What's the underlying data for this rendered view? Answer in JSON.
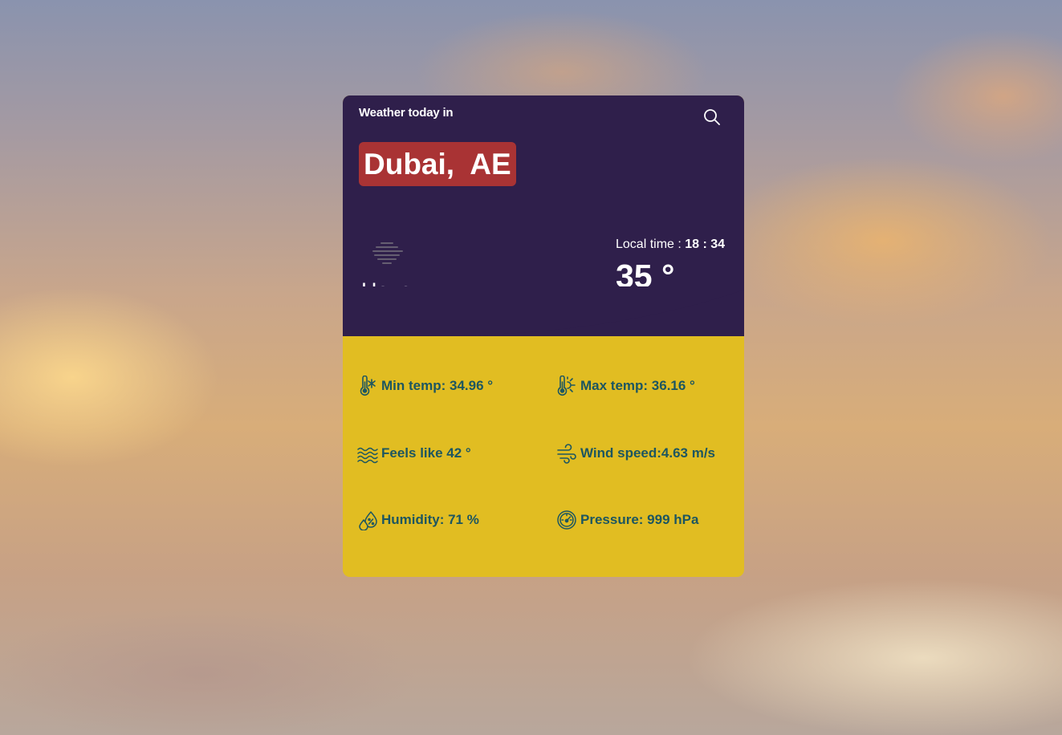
{
  "header": {
    "subtitle": "Weather today in",
    "city": "Dubai,  AE",
    "search_icon": "search-icon"
  },
  "current": {
    "condition": "Haze",
    "condition_icon": "haze-icon",
    "local_time_label": "Local time : ",
    "local_time_value": "18 : 34",
    "temperature": "35 °"
  },
  "stats": {
    "min_temp": "Min temp: 34.96 °",
    "max_temp": "Max temp: 36.16 °",
    "feels_like": "Feels like 42 °",
    "wind_speed": "Wind speed:4.63 m/s",
    "humidity": "Humidity: 71 %",
    "pressure": "Pressure: 999 hPa"
  },
  "colors": {
    "top_panel": "#2f1f4b",
    "bottom_panel": "#e1bd22",
    "city_badge": "#a93334",
    "stat_text": "#1d5660"
  }
}
